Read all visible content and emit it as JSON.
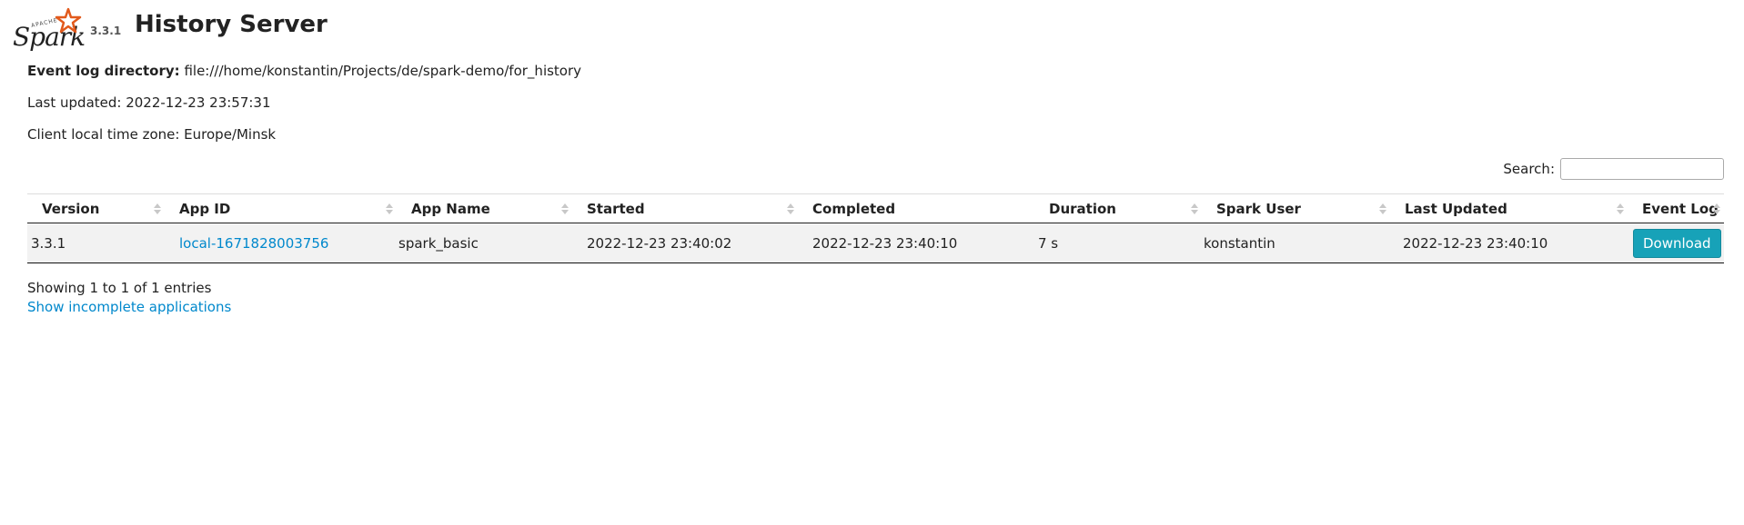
{
  "header": {
    "logo_word": "Spark",
    "logo_apache": "APACHE",
    "version": "3.3.1",
    "title": "History Server"
  },
  "info": {
    "event_log_label": "Event log directory:",
    "event_log_value": "file:///home/konstantin/Projects/de/spark-demo/for_history",
    "last_updated": "Last updated: 2022-12-23 23:57:31",
    "timezone": "Client local time zone: Europe/Minsk"
  },
  "search": {
    "label": "Search:",
    "value": ""
  },
  "table": {
    "columns": [
      "Version",
      "App ID",
      "App Name",
      "Started",
      "Completed",
      "Duration",
      "Spark User",
      "Last Updated",
      "Event Log"
    ],
    "rows": [
      {
        "version": "3.3.1",
        "app_id": "local-1671828003756",
        "app_name": "spark_basic",
        "started": "2022-12-23 23:40:02",
        "completed": "2022-12-23 23:40:10",
        "duration": "7 s",
        "spark_user": "konstantin",
        "last_updated": "2022-12-23 23:40:10",
        "event_log": "Download"
      }
    ]
  },
  "footer": {
    "showing": "Showing 1 to 1 of 1 entries",
    "show_incomplete": "Show incomplete applications"
  },
  "colors": {
    "link": "#0088cc",
    "button": "#17a2b8",
    "logo_star": "#e25a1c"
  }
}
